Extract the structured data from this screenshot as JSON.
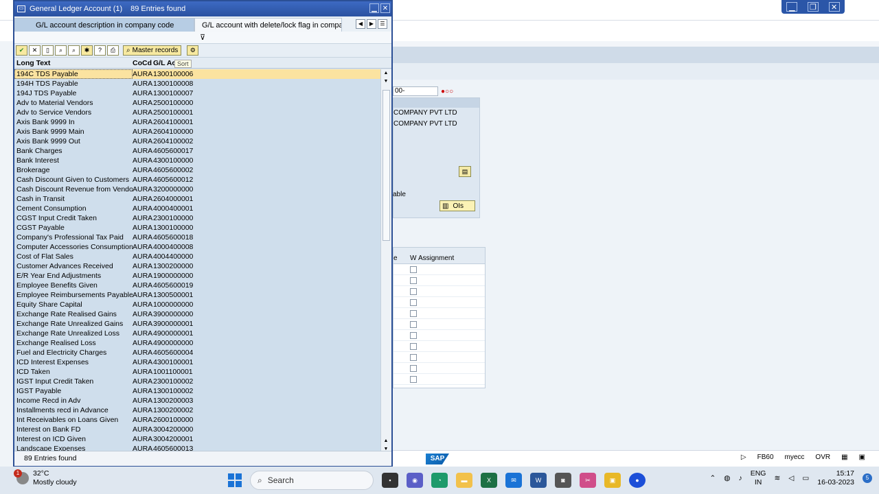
{
  "dialog": {
    "title": "General Ledger Account (1)",
    "entries_header": "89 Entries found",
    "tabs": [
      {
        "label": "G/L account description in company code"
      },
      {
        "label": "G/L account with delete/lock flag in compan..."
      }
    ],
    "toolbar": {
      "master_records_label": "Master records"
    },
    "columns": {
      "long_text": "Long Text",
      "cocd": "CoCd",
      "gl_acct": "G/L Acct"
    },
    "tooltip": "Sort",
    "rows": [
      {
        "text": "194C TDS Payable",
        "cocd": "AURA",
        "acct": "1300100006"
      },
      {
        "text": "194H TDS Payable",
        "cocd": "AURA",
        "acct": "1300100008"
      },
      {
        "text": "194J TDS Payable",
        "cocd": "AURA",
        "acct": "1300100007"
      },
      {
        "text": "Adv to Material Vendors",
        "cocd": "AURA",
        "acct": "2500100000"
      },
      {
        "text": "Adv to Service Vendors",
        "cocd": "AURA",
        "acct": "2500100001"
      },
      {
        "text": "Axis Bank 9999 In",
        "cocd": "AURA",
        "acct": "2604100001"
      },
      {
        "text": "Axis Bank 9999 Main",
        "cocd": "AURA",
        "acct": "2604100000"
      },
      {
        "text": "Axis Bank 9999 Out",
        "cocd": "AURA",
        "acct": "2604100002"
      },
      {
        "text": "Bank Charges",
        "cocd": "AURA",
        "acct": "4605600017"
      },
      {
        "text": "Bank Interest",
        "cocd": "AURA",
        "acct": "4300100000"
      },
      {
        "text": "Brokerage",
        "cocd": "AURA",
        "acct": "4605600002"
      },
      {
        "text": "Cash Discount Given to Customers",
        "cocd": "AURA",
        "acct": "4605600012"
      },
      {
        "text": "Cash Discount Revenue from Vendors",
        "cocd": "AURA",
        "acct": "3200000000"
      },
      {
        "text": "Cash in Transit",
        "cocd": "AURA",
        "acct": "2604000001"
      },
      {
        "text": "Cement Consumption",
        "cocd": "AURA",
        "acct": "4000400001"
      },
      {
        "text": "CGST Input Credit Taken",
        "cocd": "AURA",
        "acct": "2300100000"
      },
      {
        "text": "CGST Payable",
        "cocd": "AURA",
        "acct": "1300100000"
      },
      {
        "text": "Company's Professional Tax Paid",
        "cocd": "AURA",
        "acct": "4605600018"
      },
      {
        "text": "Computer Accessories Consumption",
        "cocd": "AURA",
        "acct": "4000400008"
      },
      {
        "text": "Cost of Flat Sales",
        "cocd": "AURA",
        "acct": "4004400000"
      },
      {
        "text": "Customer Advances Received",
        "cocd": "AURA",
        "acct": "1300200000"
      },
      {
        "text": "E/R Year End Adjustments",
        "cocd": "AURA",
        "acct": "1900000000"
      },
      {
        "text": "Employee Benefits Given",
        "cocd": "AURA",
        "acct": "4605600019"
      },
      {
        "text": "Employee Reimbursements Payables",
        "cocd": "AURA",
        "acct": "1300500001"
      },
      {
        "text": "Equity Share Capital",
        "cocd": "AURA",
        "acct": "1000000000"
      },
      {
        "text": "Exchange Rate Realised Gains",
        "cocd": "AURA",
        "acct": "3900000000"
      },
      {
        "text": "Exchange Rate Unrealized Gains",
        "cocd": "AURA",
        "acct": "3900000001"
      },
      {
        "text": "Exchange Rate Unrealized Loss",
        "cocd": "AURA",
        "acct": "4900000001"
      },
      {
        "text": "Exchange Realised Loss",
        "cocd": "AURA",
        "acct": "4900000000"
      },
      {
        "text": "Fuel and Electricity Charges",
        "cocd": "AURA",
        "acct": "4605600004"
      },
      {
        "text": "ICD Interest Expenses",
        "cocd": "AURA",
        "acct": "4300100001"
      },
      {
        "text": "ICD Taken",
        "cocd": "AURA",
        "acct": "1001100001"
      },
      {
        "text": "IGST Input Credit Taken",
        "cocd": "AURA",
        "acct": "2300100002"
      },
      {
        "text": "IGST Payable",
        "cocd": "AURA",
        "acct": "1300100002"
      },
      {
        "text": "Income Recd in Adv",
        "cocd": "AURA",
        "acct": "1300200003"
      },
      {
        "text": "Installments recd in Advance",
        "cocd": "AURA",
        "acct": "1300200002"
      },
      {
        "text": "Int Receivables on Loans Given",
        "cocd": "AURA",
        "acct": "2600100000"
      },
      {
        "text": "Interest on Bank FD",
        "cocd": "AURA",
        "acct": "3004200000"
      },
      {
        "text": "Interest on ICD Given",
        "cocd": "AURA",
        "acct": "3004200001"
      },
      {
        "text": "Landscape Expenses",
        "cocd": "AURA",
        "acct": "4605600013"
      }
    ],
    "status_text": "89 Entries found"
  },
  "background": {
    "field_value": "00-",
    "company_line_1": "COMPANY PVT LTD",
    "company_line_2": "COMPANY PVT LTD",
    "able_text": "able",
    "ois_label": "OIs",
    "table_header_w": "W",
    "table_header_assignment": "Assignment",
    "table_header_e": "e",
    "sap_logo": "SAP",
    "tcode": "FB60",
    "system": "myecc",
    "mode": "OVR"
  },
  "taskbar": {
    "weather_temp": "32°C",
    "weather_desc": "Mostly cloudy",
    "weather_badge": "1",
    "search_placeholder": "Search",
    "lang_1": "ENG",
    "lang_2": "IN",
    "time": "15:17",
    "date": "16-03-2023",
    "notification_count": "5"
  },
  "colors": {
    "dialog_title": "#2a51a0",
    "selected_row": "#fbe3a0",
    "list_bg": "#cfdeec"
  }
}
